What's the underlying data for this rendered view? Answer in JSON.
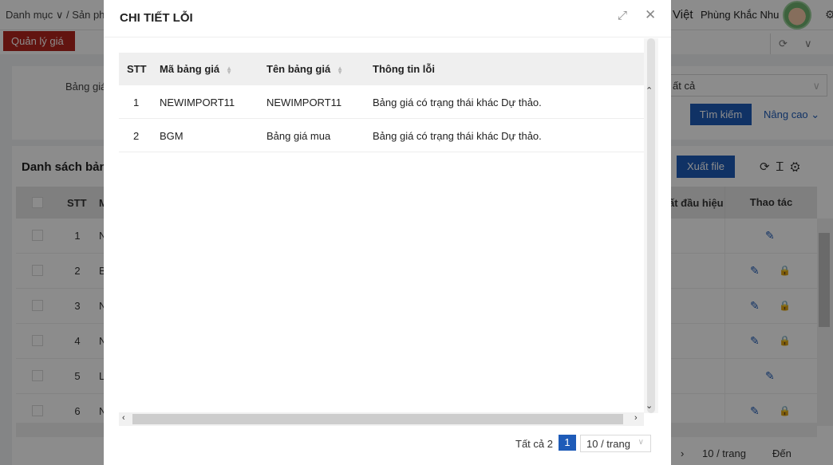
{
  "background": {
    "breadcrumb": "Danh mục ∨  /  Sản ph",
    "language": "Việt",
    "user_name": "Phùng Khắc Nhu",
    "active_tab": "Quản lý giá",
    "filter_label": "Bảng giá",
    "filter_select": "ất cả",
    "search_button": "Tìm kiếm",
    "advanced_link": "Nâng cao",
    "list_title": "Danh sách bảng",
    "export_button": "Xuất file",
    "header_stt": "STT",
    "header_m": "M",
    "header_sign": "ất đầu hiệu",
    "header_actions": "Thao tác",
    "rows": [
      {
        "n": "1",
        "c": "N"
      },
      {
        "n": "2",
        "c": "B"
      },
      {
        "n": "3",
        "c": "N"
      },
      {
        "n": "4",
        "c": "N"
      },
      {
        "n": "5",
        "c": "L"
      },
      {
        "n": "6",
        "c": "N"
      }
    ],
    "pager_size": "10 / trang",
    "pager_goto": "Đến"
  },
  "modal": {
    "title": "CHI TIẾT LỖI",
    "columns": {
      "stt": "STT",
      "code": "Mã bảng giá",
      "name": "Tên bảng giá",
      "error": "Thông tin lỗi"
    },
    "rows": [
      {
        "stt": "1",
        "code": "NEWIMPORT11",
        "name": "NEWIMPORT11",
        "error": "Bảng giá có trạng thái khác Dự thảo."
      },
      {
        "stt": "2",
        "code": "BGM",
        "name": "Bảng giá mua",
        "error": "Bảng giá có trạng thái khác Dự thảo."
      }
    ],
    "pagination": {
      "total": "Tất cả 2",
      "current_page": "1",
      "page_size": "10 / trang"
    }
  },
  "colors": {
    "accent": "#1e5bb8",
    "tab_red": "#b3261e"
  }
}
